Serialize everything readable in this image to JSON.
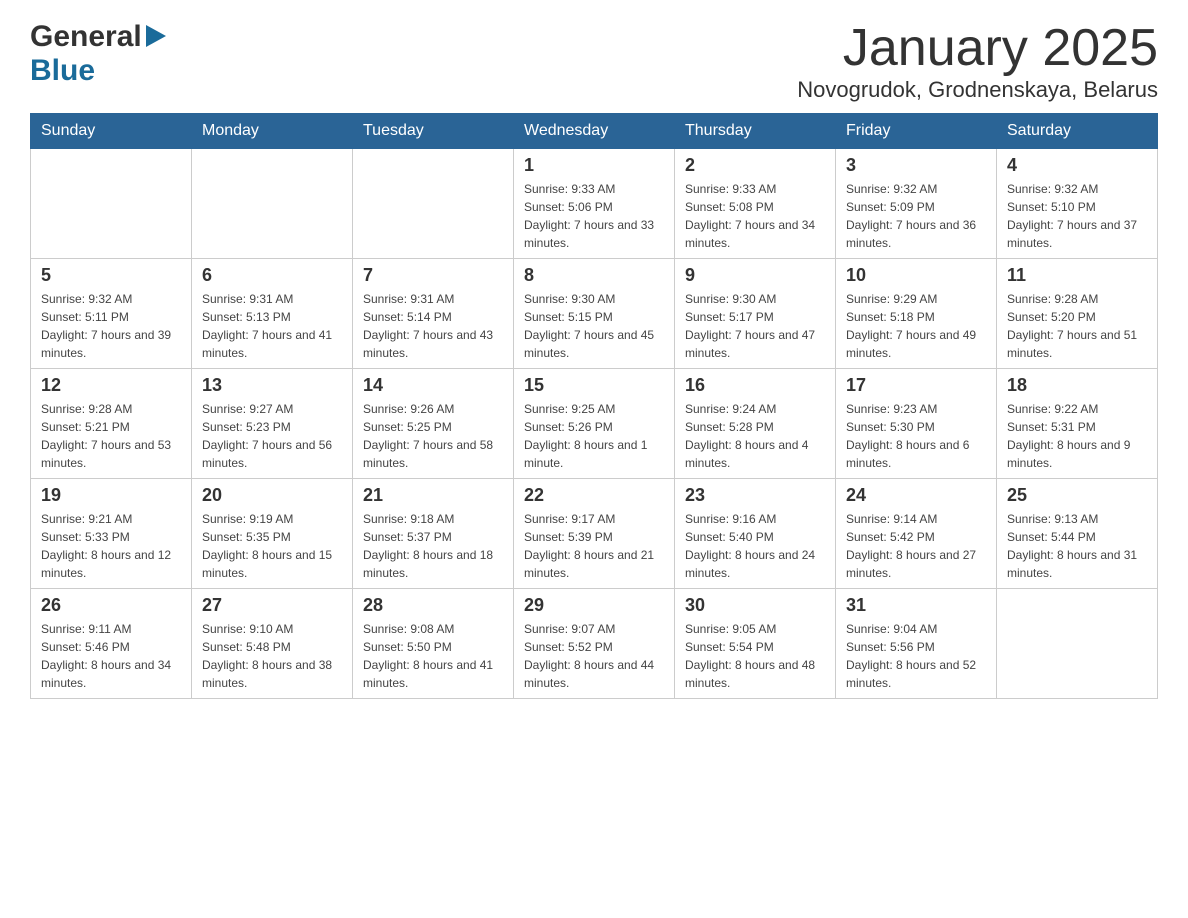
{
  "header": {
    "month_title": "January 2025",
    "location": "Novogrudok, Grodnenskaya, Belarus"
  },
  "logo": {
    "line1": "General",
    "line2": "Blue"
  },
  "days_of_week": [
    "Sunday",
    "Monday",
    "Tuesday",
    "Wednesday",
    "Thursday",
    "Friday",
    "Saturday"
  ],
  "weeks": [
    [
      {
        "day": "",
        "sunrise": "",
        "sunset": "",
        "daylight": ""
      },
      {
        "day": "",
        "sunrise": "",
        "sunset": "",
        "daylight": ""
      },
      {
        "day": "",
        "sunrise": "",
        "sunset": "",
        "daylight": ""
      },
      {
        "day": "1",
        "sunrise": "Sunrise: 9:33 AM",
        "sunset": "Sunset: 5:06 PM",
        "daylight": "Daylight: 7 hours and 33 minutes."
      },
      {
        "day": "2",
        "sunrise": "Sunrise: 9:33 AM",
        "sunset": "Sunset: 5:08 PM",
        "daylight": "Daylight: 7 hours and 34 minutes."
      },
      {
        "day": "3",
        "sunrise": "Sunrise: 9:32 AM",
        "sunset": "Sunset: 5:09 PM",
        "daylight": "Daylight: 7 hours and 36 minutes."
      },
      {
        "day": "4",
        "sunrise": "Sunrise: 9:32 AM",
        "sunset": "Sunset: 5:10 PM",
        "daylight": "Daylight: 7 hours and 37 minutes."
      }
    ],
    [
      {
        "day": "5",
        "sunrise": "Sunrise: 9:32 AM",
        "sunset": "Sunset: 5:11 PM",
        "daylight": "Daylight: 7 hours and 39 minutes."
      },
      {
        "day": "6",
        "sunrise": "Sunrise: 9:31 AM",
        "sunset": "Sunset: 5:13 PM",
        "daylight": "Daylight: 7 hours and 41 minutes."
      },
      {
        "day": "7",
        "sunrise": "Sunrise: 9:31 AM",
        "sunset": "Sunset: 5:14 PM",
        "daylight": "Daylight: 7 hours and 43 minutes."
      },
      {
        "day": "8",
        "sunrise": "Sunrise: 9:30 AM",
        "sunset": "Sunset: 5:15 PM",
        "daylight": "Daylight: 7 hours and 45 minutes."
      },
      {
        "day": "9",
        "sunrise": "Sunrise: 9:30 AM",
        "sunset": "Sunset: 5:17 PM",
        "daylight": "Daylight: 7 hours and 47 minutes."
      },
      {
        "day": "10",
        "sunrise": "Sunrise: 9:29 AM",
        "sunset": "Sunset: 5:18 PM",
        "daylight": "Daylight: 7 hours and 49 minutes."
      },
      {
        "day": "11",
        "sunrise": "Sunrise: 9:28 AM",
        "sunset": "Sunset: 5:20 PM",
        "daylight": "Daylight: 7 hours and 51 minutes."
      }
    ],
    [
      {
        "day": "12",
        "sunrise": "Sunrise: 9:28 AM",
        "sunset": "Sunset: 5:21 PM",
        "daylight": "Daylight: 7 hours and 53 minutes."
      },
      {
        "day": "13",
        "sunrise": "Sunrise: 9:27 AM",
        "sunset": "Sunset: 5:23 PM",
        "daylight": "Daylight: 7 hours and 56 minutes."
      },
      {
        "day": "14",
        "sunrise": "Sunrise: 9:26 AM",
        "sunset": "Sunset: 5:25 PM",
        "daylight": "Daylight: 7 hours and 58 minutes."
      },
      {
        "day": "15",
        "sunrise": "Sunrise: 9:25 AM",
        "sunset": "Sunset: 5:26 PM",
        "daylight": "Daylight: 8 hours and 1 minute."
      },
      {
        "day": "16",
        "sunrise": "Sunrise: 9:24 AM",
        "sunset": "Sunset: 5:28 PM",
        "daylight": "Daylight: 8 hours and 4 minutes."
      },
      {
        "day": "17",
        "sunrise": "Sunrise: 9:23 AM",
        "sunset": "Sunset: 5:30 PM",
        "daylight": "Daylight: 8 hours and 6 minutes."
      },
      {
        "day": "18",
        "sunrise": "Sunrise: 9:22 AM",
        "sunset": "Sunset: 5:31 PM",
        "daylight": "Daylight: 8 hours and 9 minutes."
      }
    ],
    [
      {
        "day": "19",
        "sunrise": "Sunrise: 9:21 AM",
        "sunset": "Sunset: 5:33 PM",
        "daylight": "Daylight: 8 hours and 12 minutes."
      },
      {
        "day": "20",
        "sunrise": "Sunrise: 9:19 AM",
        "sunset": "Sunset: 5:35 PM",
        "daylight": "Daylight: 8 hours and 15 minutes."
      },
      {
        "day": "21",
        "sunrise": "Sunrise: 9:18 AM",
        "sunset": "Sunset: 5:37 PM",
        "daylight": "Daylight: 8 hours and 18 minutes."
      },
      {
        "day": "22",
        "sunrise": "Sunrise: 9:17 AM",
        "sunset": "Sunset: 5:39 PM",
        "daylight": "Daylight: 8 hours and 21 minutes."
      },
      {
        "day": "23",
        "sunrise": "Sunrise: 9:16 AM",
        "sunset": "Sunset: 5:40 PM",
        "daylight": "Daylight: 8 hours and 24 minutes."
      },
      {
        "day": "24",
        "sunrise": "Sunrise: 9:14 AM",
        "sunset": "Sunset: 5:42 PM",
        "daylight": "Daylight: 8 hours and 27 minutes."
      },
      {
        "day": "25",
        "sunrise": "Sunrise: 9:13 AM",
        "sunset": "Sunset: 5:44 PM",
        "daylight": "Daylight: 8 hours and 31 minutes."
      }
    ],
    [
      {
        "day": "26",
        "sunrise": "Sunrise: 9:11 AM",
        "sunset": "Sunset: 5:46 PM",
        "daylight": "Daylight: 8 hours and 34 minutes."
      },
      {
        "day": "27",
        "sunrise": "Sunrise: 9:10 AM",
        "sunset": "Sunset: 5:48 PM",
        "daylight": "Daylight: 8 hours and 38 minutes."
      },
      {
        "day": "28",
        "sunrise": "Sunrise: 9:08 AM",
        "sunset": "Sunset: 5:50 PM",
        "daylight": "Daylight: 8 hours and 41 minutes."
      },
      {
        "day": "29",
        "sunrise": "Sunrise: 9:07 AM",
        "sunset": "Sunset: 5:52 PM",
        "daylight": "Daylight: 8 hours and 44 minutes."
      },
      {
        "day": "30",
        "sunrise": "Sunrise: 9:05 AM",
        "sunset": "Sunset: 5:54 PM",
        "daylight": "Daylight: 8 hours and 48 minutes."
      },
      {
        "day": "31",
        "sunrise": "Sunrise: 9:04 AM",
        "sunset": "Sunset: 5:56 PM",
        "daylight": "Daylight: 8 hours and 52 minutes."
      },
      {
        "day": "",
        "sunrise": "",
        "sunset": "",
        "daylight": ""
      }
    ]
  ]
}
